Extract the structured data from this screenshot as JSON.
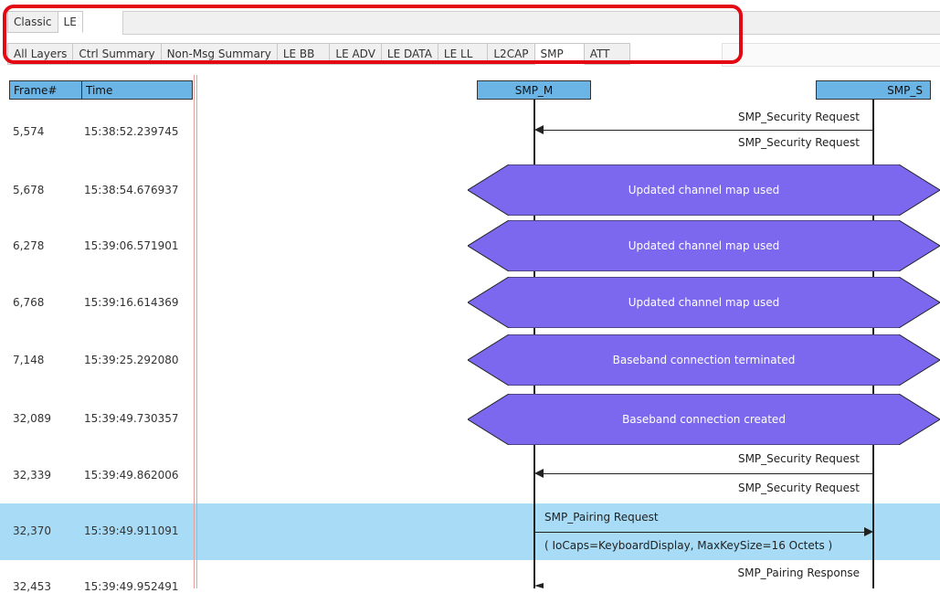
{
  "protocol_tabs": [
    "Classic",
    "LE"
  ],
  "layer_tabs": [
    "All Layers",
    "Ctrl Summary",
    "Non-Msg Summary",
    "LE BB",
    "LE ADV",
    "LE DATA",
    "LE LL",
    "L2CAP",
    "SMP",
    "ATT"
  ],
  "active_layer_tab": "SMP",
  "columns": {
    "frame": "Frame#",
    "time": "Time"
  },
  "lifelines": {
    "master": "SMP_M",
    "slave": "SMP_S"
  },
  "rows": [
    {
      "frame": "5,574",
      "time": "15:38:52.239745",
      "labels": [
        "SMP_Security Request",
        "SMP_Security Request"
      ]
    },
    {
      "frame": "5,678",
      "time": "15:38:54.676937",
      "event": "Updated channel map used"
    },
    {
      "frame": "6,278",
      "time": "15:39:06.571901",
      "event": "Updated channel map used"
    },
    {
      "frame": "6,768",
      "time": "15:39:16.614369",
      "event": "Updated channel map used"
    },
    {
      "frame": "7,148",
      "time": "15:39:25.292080",
      "event": "Baseband connection terminated"
    },
    {
      "frame": "32,089",
      "time": "15:39:49.730357",
      "event": "Baseband connection created"
    },
    {
      "frame": "32,339",
      "time": "15:39:49.862006",
      "labels": [
        "SMP_Security Request",
        "SMP_Security Request"
      ]
    },
    {
      "frame": "32,370",
      "time": "15:39:49.911091",
      "labels": [
        "SMP_Pairing Request",
        "( IoCaps=KeyboardDisplay, MaxKeySize=16 Octets )"
      ],
      "selected": true
    },
    {
      "frame": "32,453",
      "time": "15:39:49.952491",
      "labels": [
        "SMP_Pairing Response"
      ]
    }
  ],
  "colors": {
    "event_fill": "#7b68ee",
    "header_fill": "#6bb5e6",
    "selected_row": "#a8dcf6",
    "highlight_border": "#e30613"
  }
}
